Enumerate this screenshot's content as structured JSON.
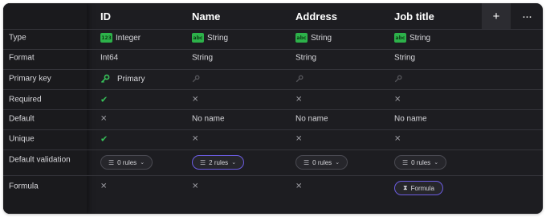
{
  "columns": [
    {
      "title": "ID"
    },
    {
      "title": "Name"
    },
    {
      "title": "Address"
    },
    {
      "title": "Job title"
    }
  ],
  "header_buttons": {
    "add": "+",
    "more": "···"
  },
  "row_labels": {
    "type": "Type",
    "format": "Format",
    "primary_key": "Primary key",
    "required": "Required",
    "default": "Default",
    "unique": "Unique",
    "default_validation": "Default validation",
    "formula": "Formula"
  },
  "types": [
    {
      "badge": "123",
      "label": "Integer"
    },
    {
      "badge": "abc",
      "label": "String"
    },
    {
      "badge": "abc",
      "label": "String"
    },
    {
      "badge": "abc",
      "label": "String"
    }
  ],
  "formats": [
    "Int64",
    "String",
    "String",
    "String"
  ],
  "primary_key": {
    "label": "Primary",
    "flags": [
      true,
      false,
      false,
      false
    ]
  },
  "required": [
    true,
    false,
    false,
    false
  ],
  "defaults": [
    null,
    "No name",
    "No name",
    "No name"
  ],
  "unique": [
    true,
    false,
    false,
    false
  ],
  "validation": [
    {
      "label": "0 rules",
      "active": false
    },
    {
      "label": "2 rules",
      "active": true
    },
    {
      "label": "0 rules",
      "active": false
    },
    {
      "label": "0 rules",
      "active": false
    }
  ],
  "formula": {
    "label": "Formula",
    "flags": [
      false,
      false,
      false,
      true
    ]
  },
  "colors": {
    "accent": "#6b5ce0",
    "check": "#38c25a",
    "type_badge": "#2db24a",
    "background": "#1d1d21"
  },
  "icons": {
    "check": "check-icon",
    "cross": "cross-icon",
    "key": "key-icon",
    "rules": "rules-icon",
    "chevron": "chevron-down-icon",
    "sigma": "sigma-icon"
  }
}
